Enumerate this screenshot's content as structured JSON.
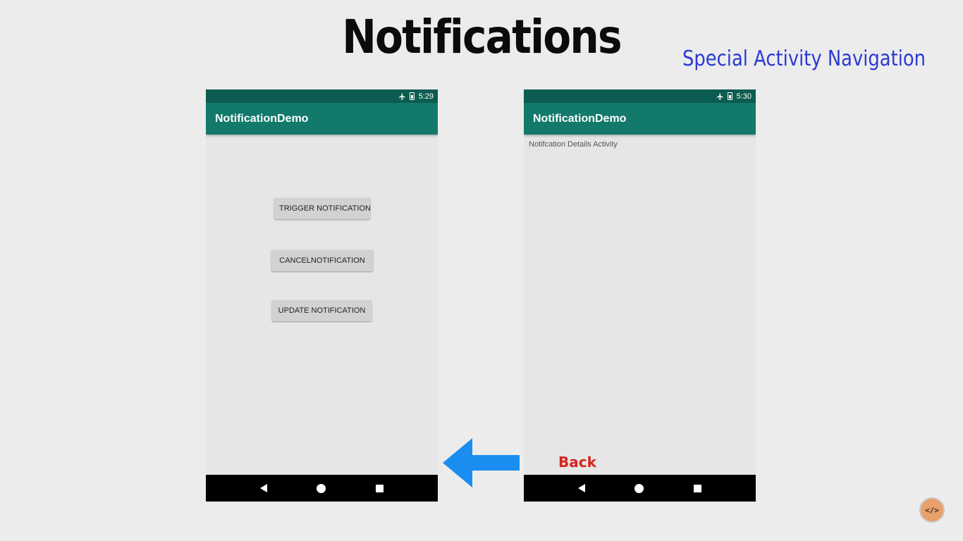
{
  "slide": {
    "title": "Notifications",
    "subtitle": "Special Activity Navigation",
    "back_label": "Back"
  },
  "left_phone": {
    "time": "5:29",
    "app_title": "NotificationDemo",
    "buttons": {
      "trigger": "TRIGGER NOTIFICATION",
      "cancel": "CANCELNOTIFICATION",
      "update": "UPDATE NOTIFICATION"
    }
  },
  "right_phone": {
    "time": "5:30",
    "app_title": "NotificationDemo",
    "content_text": "Notifcation Details Activity"
  },
  "logo": {
    "glyph": "</>"
  },
  "icons": {
    "status": [
      "airplane-icon",
      "battery-icon"
    ],
    "nav": [
      "back-icon",
      "home-icon",
      "recents-icon"
    ],
    "arrow": "left-arrow-icon"
  },
  "colors": {
    "status_bar": "#0d5c50",
    "app_bar": "#12796b",
    "subtitle": "#2b3ad6",
    "back_label": "#d8231c",
    "arrow": "#1a8ef0"
  }
}
